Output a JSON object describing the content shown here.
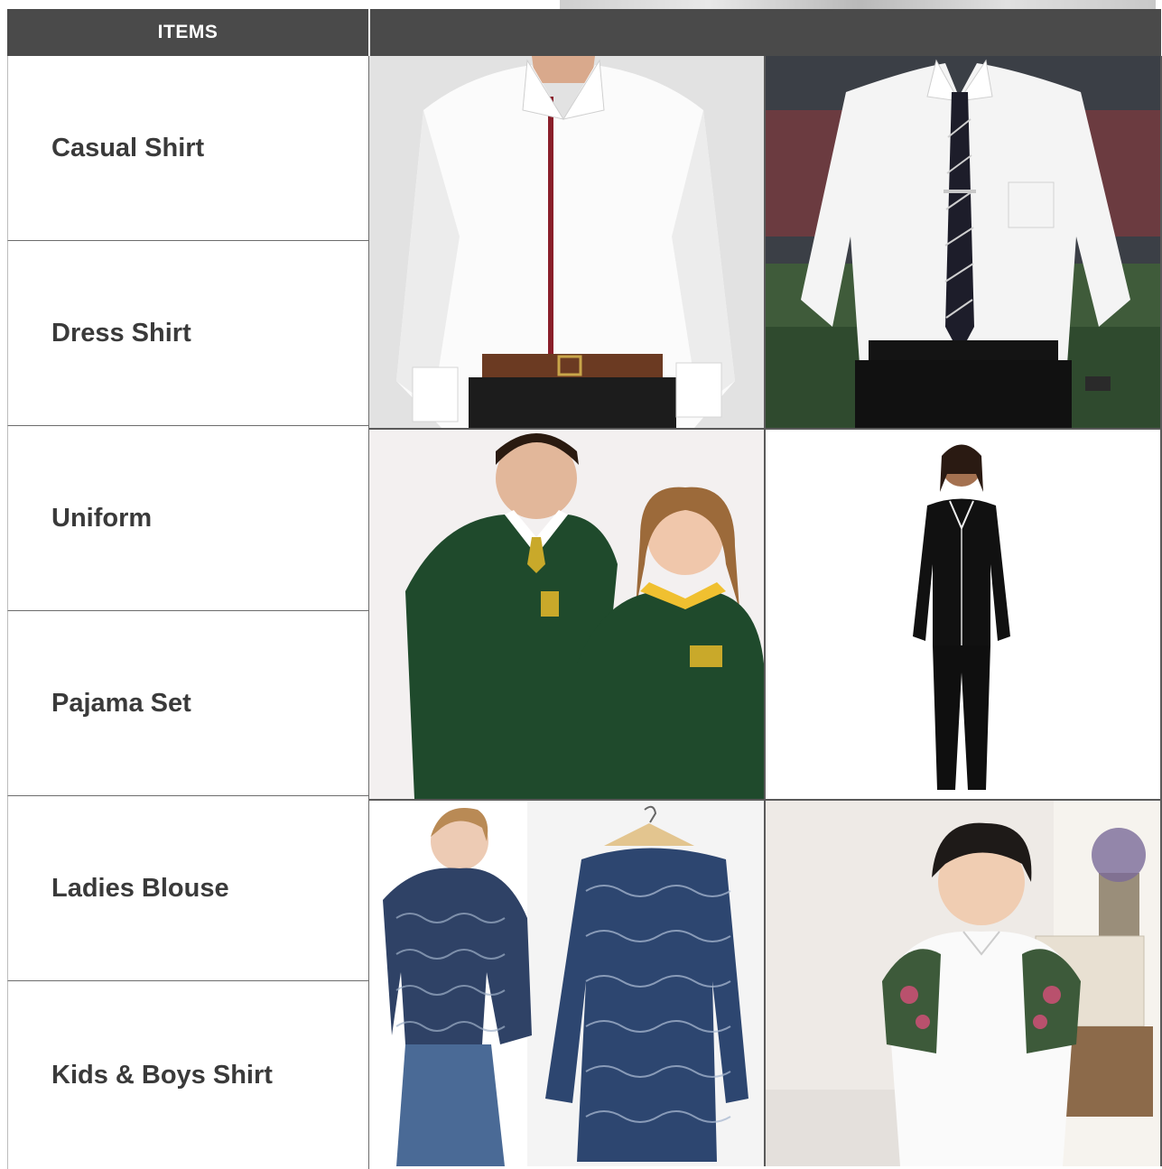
{
  "header": {
    "items_label": "ITEMS"
  },
  "rows": [
    {
      "label": "Casual Shirt"
    },
    {
      "label": "Dress Shirt"
    },
    {
      "label": "Uniform"
    },
    {
      "label": "Pajama Set"
    },
    {
      "label": "Ladies Blouse"
    },
    {
      "label": "Kids & Boys Shirt"
    }
  ]
}
